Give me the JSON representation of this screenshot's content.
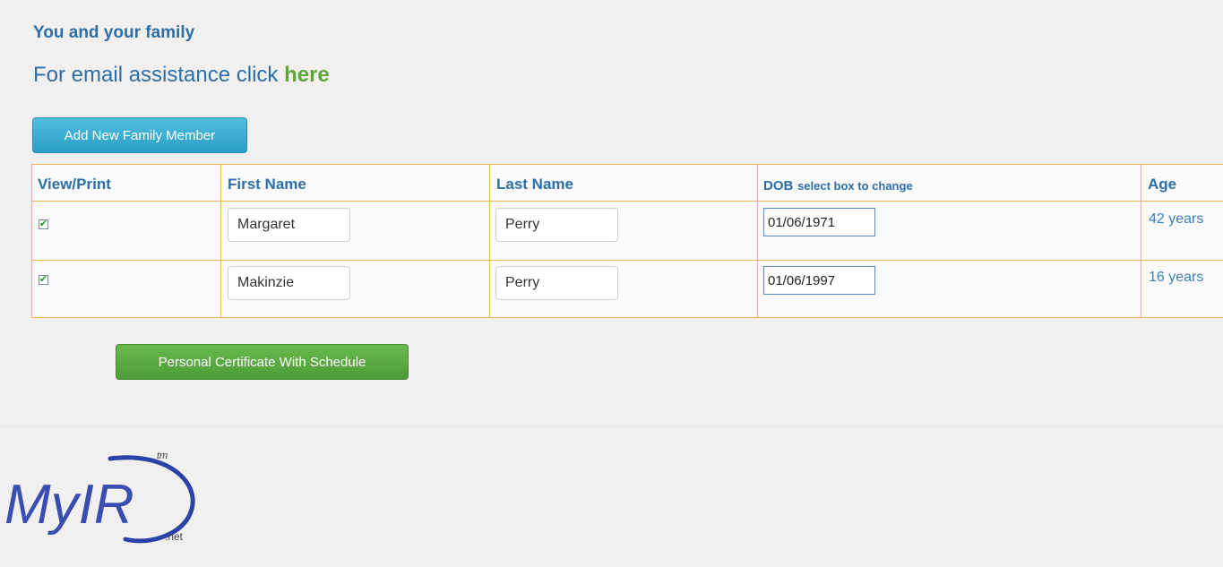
{
  "header": {
    "title": "You and your family",
    "assist_prefix": "For email assistance click ",
    "assist_link": "here"
  },
  "buttons": {
    "add_member": "Add New Family Member",
    "certificate": "Personal Certificate With Schedule"
  },
  "table": {
    "columns": {
      "view_print": "View/Print",
      "first_name": "First Name",
      "last_name": "Last Name",
      "dob": "DOB",
      "dob_hint": "select box to change",
      "age": "Age"
    },
    "rows": [
      {
        "checked": true,
        "first_name": "Margaret",
        "last_name": "Perry",
        "dob": "01/06/1971",
        "age": "42 years"
      },
      {
        "checked": true,
        "first_name": "Makinzie",
        "last_name": "Perry",
        "dob": "01/06/1997",
        "age": "16 years"
      }
    ]
  },
  "logo": {
    "text": "MyIR",
    "tm": "tm",
    "suffix": ".net"
  },
  "colors": {
    "heading_blue": "#2c6fa8",
    "link_green": "#5ea83b",
    "table_border": "#f0b35a",
    "add_button": "#2b9ec5",
    "certificate_button": "#4e9c38"
  }
}
